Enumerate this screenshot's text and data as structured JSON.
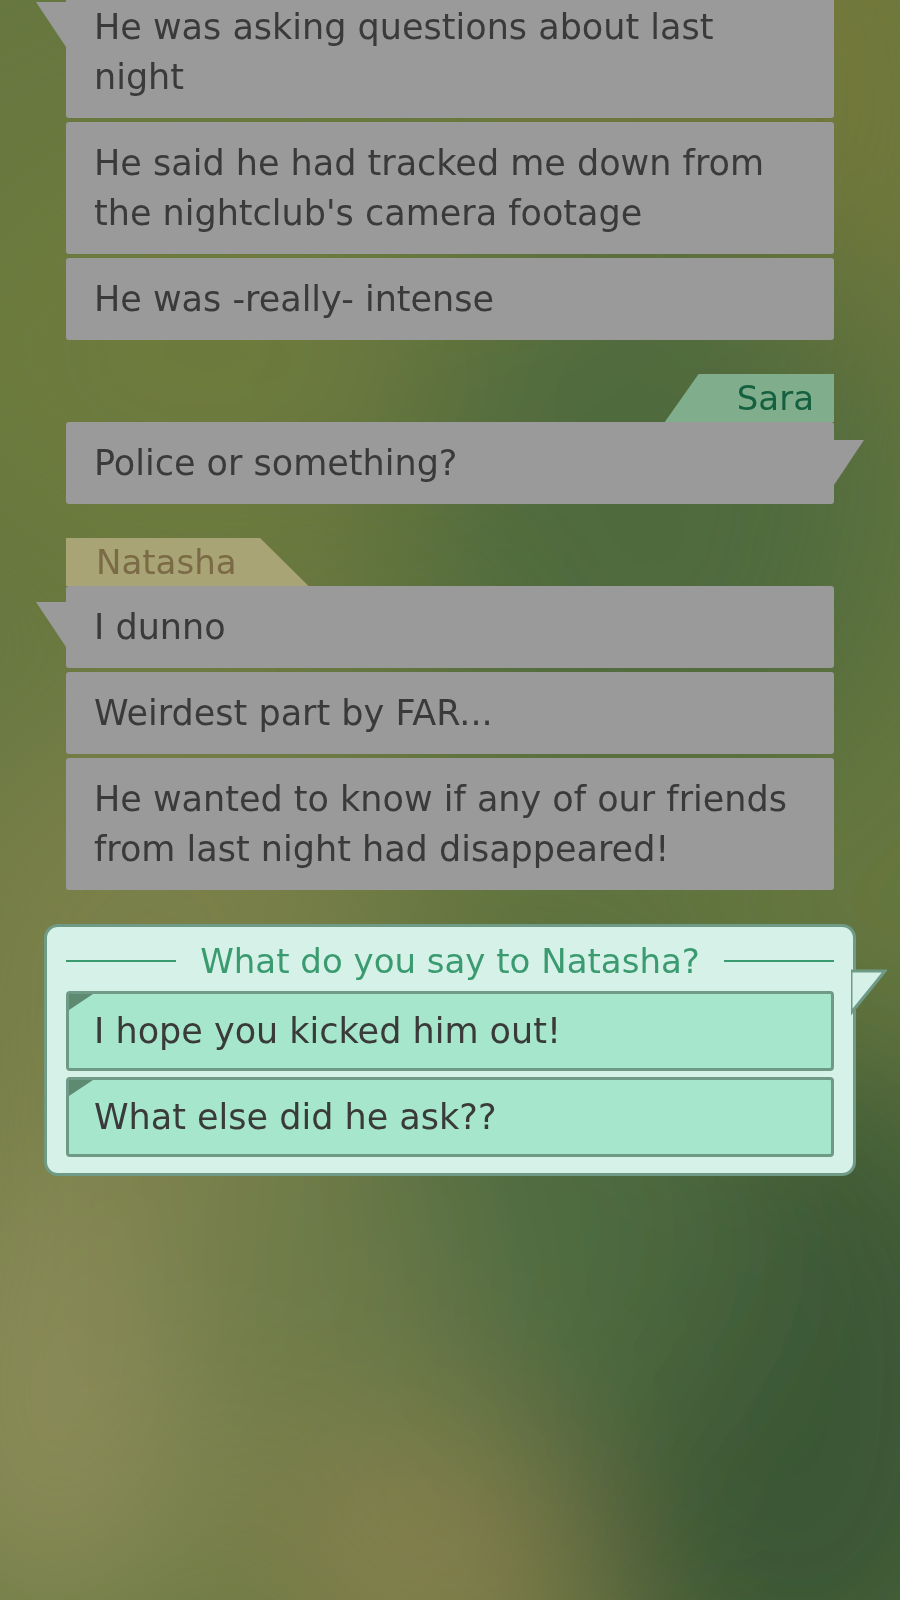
{
  "conversation": [
    {
      "kind": "incoming",
      "messages": [
        "He was asking questions about last night",
        "He said he had tracked me down from the nightclub's camera footage",
        "He was -really- intense"
      ]
    },
    {
      "sender": "Sara",
      "kind": "outgoing",
      "messages": [
        "Police or something?"
      ]
    },
    {
      "sender": "Natasha",
      "kind": "incoming",
      "messages": [
        "I dunno",
        "Weirdest part by FAR...",
        "He wanted to know if any of our friends from last night had disappeared!"
      ]
    }
  ],
  "choice": {
    "prompt": "What do you say to Natasha?",
    "options": [
      "I hope you kicked him out!",
      "What else did he ask??"
    ]
  }
}
